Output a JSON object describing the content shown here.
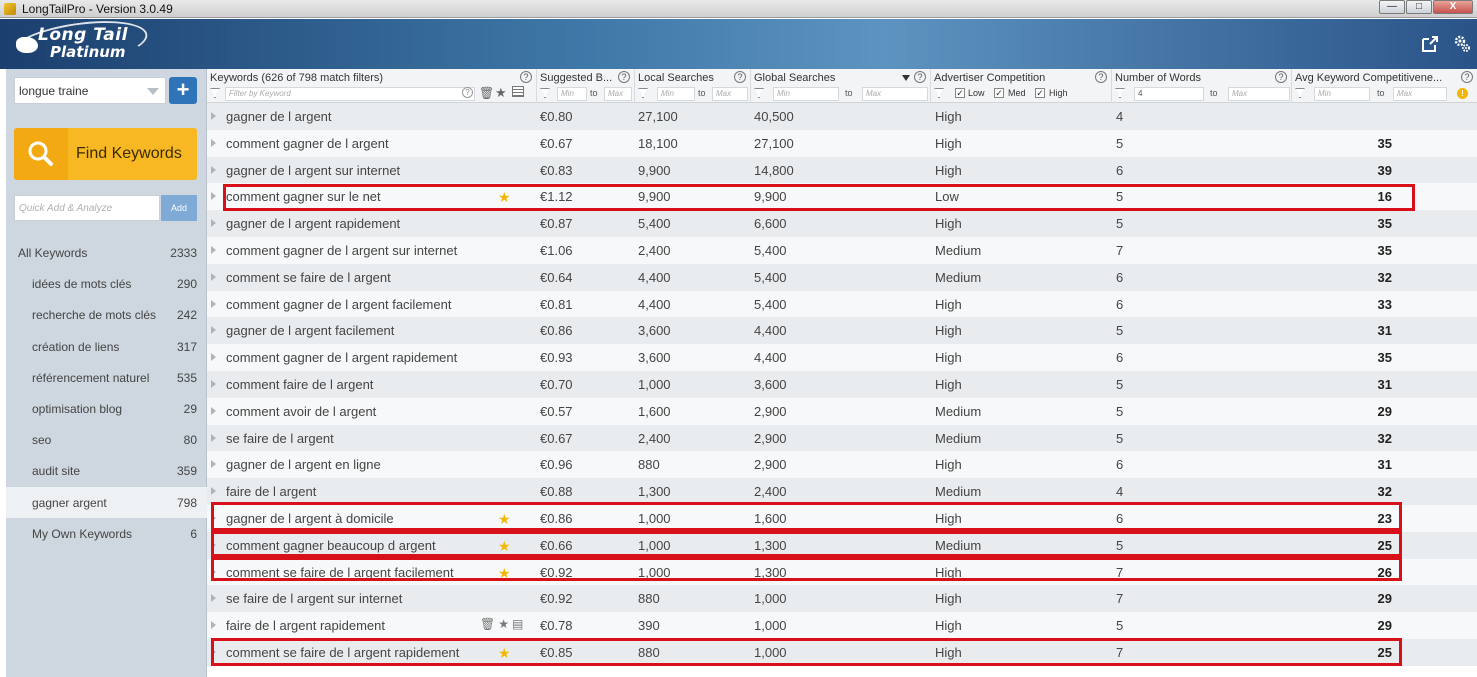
{
  "window": {
    "title": "LongTailPro - Version 3.0.49",
    "controls": {
      "minimize": "—",
      "maximize": "□",
      "close": "X"
    }
  },
  "brand": {
    "line1": "Long Tail",
    "line2": "Platinum"
  },
  "header_icons": [
    "external-link-icon",
    "settings-gear-icon"
  ],
  "sidebar": {
    "project": "longue traine",
    "add_project_label": "+",
    "find_keywords_label": "Find Keywords",
    "quick_add_placeholder": "Quick Add & Analyze",
    "quick_add_button": "Add",
    "lists": [
      {
        "name": "All Keywords",
        "count": "2333"
      },
      {
        "name": "idées de mots clés",
        "count": "290"
      },
      {
        "name": "recherche de mots clés",
        "count": "242"
      },
      {
        "name": "création de liens",
        "count": "317"
      },
      {
        "name": "référencement naturel",
        "count": "535"
      },
      {
        "name": "optimisation blog",
        "count": "29"
      },
      {
        "name": "seo",
        "count": "80"
      },
      {
        "name": "audit site",
        "count": "359"
      },
      {
        "name": "gagner argent",
        "count": "798"
      },
      {
        "name": "My Own Keywords",
        "count": "6"
      }
    ]
  },
  "grid": {
    "headers": {
      "keyword": "Keywords (626 of 798 match filters)",
      "bid": "Suggested B...",
      "local": "Local Searches",
      "global": "Global Searches",
      "competition": "Advertiser Competition",
      "words": "Number of Words",
      "avg": "Avg Keyword Competitivene..."
    },
    "filters": {
      "keyword_placeholder": "Filter by Keyword",
      "min": "Min",
      "max": "Max",
      "to": "to",
      "words_min_value": "4",
      "comp_low": "Low",
      "comp_med": "Med",
      "comp_high": "High"
    },
    "rows": [
      {
        "kw": "gagner de l argent",
        "bid": "€0.80",
        "local": "27,100",
        "global": "40,500",
        "comp": "High",
        "words": "4",
        "avg": "",
        "star": false
      },
      {
        "kw": "comment gagner de l argent",
        "bid": "€0.67",
        "local": "18,100",
        "global": "27,100",
        "comp": "High",
        "words": "5",
        "avg": "35",
        "star": false
      },
      {
        "kw": "gagner de l argent sur internet",
        "bid": "€0.83",
        "local": "9,900",
        "global": "14,800",
        "comp": "High",
        "words": "6",
        "avg": "39",
        "star": false
      },
      {
        "kw": "comment gagner sur le net",
        "bid": "€1.12",
        "local": "9,900",
        "global": "9,900",
        "comp": "Low",
        "words": "5",
        "avg": "16",
        "star": true
      },
      {
        "kw": "gagner de l argent rapidement",
        "bid": "€0.87",
        "local": "5,400",
        "global": "6,600",
        "comp": "High",
        "words": "5",
        "avg": "35",
        "star": false
      },
      {
        "kw": "comment gagner de l argent sur internet",
        "bid": "€1.06",
        "local": "2,400",
        "global": "5,400",
        "comp": "Medium",
        "words": "7",
        "avg": "35",
        "star": false
      },
      {
        "kw": "comment se faire de l argent",
        "bid": "€0.64",
        "local": "4,400",
        "global": "5,400",
        "comp": "Medium",
        "words": "6",
        "avg": "32",
        "star": false
      },
      {
        "kw": "comment gagner de l argent facilement",
        "bid": "€0.81",
        "local": "4,400",
        "global": "5,400",
        "comp": "High",
        "words": "6",
        "avg": "33",
        "star": false
      },
      {
        "kw": "gagner de l argent facilement",
        "bid": "€0.86",
        "local": "3,600",
        "global": "4,400",
        "comp": "High",
        "words": "5",
        "avg": "31",
        "star": false
      },
      {
        "kw": "comment gagner de l argent rapidement",
        "bid": "€0.93",
        "local": "3,600",
        "global": "4,400",
        "comp": "High",
        "words": "6",
        "avg": "35",
        "star": false
      },
      {
        "kw": "comment faire de l argent",
        "bid": "€0.70",
        "local": "1,000",
        "global": "3,600",
        "comp": "High",
        "words": "5",
        "avg": "31",
        "star": false
      },
      {
        "kw": "comment avoir de l argent",
        "bid": "€0.57",
        "local": "1,600",
        "global": "2,900",
        "comp": "Medium",
        "words": "5",
        "avg": "29",
        "star": false
      },
      {
        "kw": "se faire de l argent",
        "bid": "€0.67",
        "local": "2,400",
        "global": "2,900",
        "comp": "Medium",
        "words": "5",
        "avg": "32",
        "star": false
      },
      {
        "kw": "gagner de l argent en ligne",
        "bid": "€0.96",
        "local": "880",
        "global": "2,900",
        "comp": "High",
        "words": "6",
        "avg": "31",
        "star": false
      },
      {
        "kw": "faire de l argent",
        "bid": "€0.88",
        "local": "1,300",
        "global": "2,400",
        "comp": "Medium",
        "words": "4",
        "avg": "32",
        "star": false
      },
      {
        "kw": "gagner de l argent à domicile",
        "bid": "€0.86",
        "local": "1,000",
        "global": "1,600",
        "comp": "High",
        "words": "6",
        "avg": "23",
        "star": true
      },
      {
        "kw": "comment gagner beaucoup d argent",
        "bid": "€0.66",
        "local": "1,000",
        "global": "1,300",
        "comp": "Medium",
        "words": "5",
        "avg": "25",
        "star": true
      },
      {
        "kw": "comment se faire de l argent facilement",
        "bid": "€0.92",
        "local": "1,000",
        "global": "1,300",
        "comp": "High",
        "words": "7",
        "avg": "26",
        "star": true
      },
      {
        "kw": "se faire de l argent sur internet",
        "bid": "€0.92",
        "local": "880",
        "global": "1,000",
        "comp": "High",
        "words": "7",
        "avg": "29",
        "star": false
      },
      {
        "kw": "faire de l argent rapidement",
        "bid": "€0.78",
        "local": "390",
        "global": "1,000",
        "comp": "High",
        "words": "5",
        "avg": "29",
        "star": false,
        "tools": true
      },
      {
        "kw": "comment se faire de l argent rapidement",
        "bid": "€0.85",
        "local": "880",
        "global": "1,000",
        "comp": "High",
        "words": "7",
        "avg": "25",
        "star": true
      }
    ]
  },
  "colors": {
    "highlight": "#d8101a",
    "star": "#f2b705",
    "accent": "#2f73b8",
    "find_button": "#f7b823"
  }
}
